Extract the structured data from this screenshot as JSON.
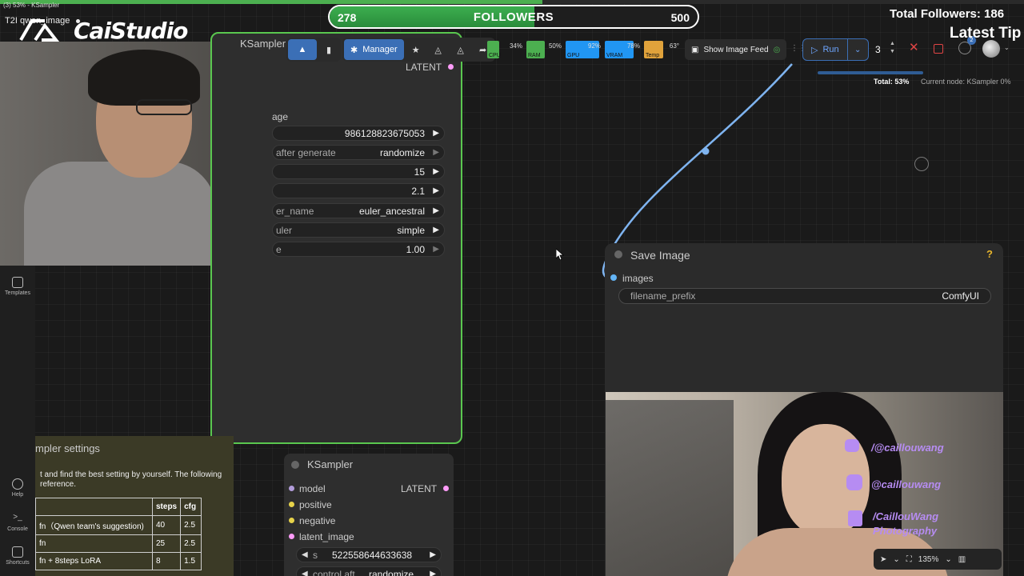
{
  "window": {
    "title": "(3) 53% - KSampler"
  },
  "workflow_tab": {
    "name": "T2I qwen_image"
  },
  "overlay": {
    "logo_text": "CaiStudio",
    "followers": {
      "current": "278",
      "label": "FOLLOWERS",
      "goal": "500",
      "progress": 0.556
    },
    "total_followers": "Total Followers: 186",
    "latest_tip": "Latest Tip",
    "socials": [
      {
        "icon": "youtube-icon",
        "handle": "/@caillouwang"
      },
      {
        "icon": "instagram-icon",
        "handle": "@caillouwang"
      },
      {
        "icon": "facebook-icon",
        "handle": "/CaillouWang"
      },
      {
        "icon": "",
        "handle": "Photography"
      }
    ]
  },
  "toolbar": {
    "manager_label": "Manager",
    "monitors": [
      {
        "label": "CPU",
        "pct": "34%",
        "color": "#4caf50"
      },
      {
        "label": "RAM",
        "pct": "50%",
        "color": "#4caf50"
      },
      {
        "label": "GPU",
        "pct": "92%",
        "color": "#2196f3"
      },
      {
        "label": "VRAM",
        "pct": "78%",
        "color": "#2196f3"
      },
      {
        "label": "Temp",
        "pct": "63°",
        "color": "#e0a23b"
      }
    ],
    "show_feed_label": "Show Image Feed",
    "run_label": "Run",
    "batch_count": "3",
    "queue_badge": "2"
  },
  "progress": {
    "total": "Total: 53%",
    "current_node": "Current node: KSampler 0%"
  },
  "ksampler_top": {
    "title": "KSampler",
    "output": "LATENT",
    "image_label": "age",
    "widgets": [
      {
        "label": "",
        "value": "986128823675053",
        "dim": false
      },
      {
        "label": "after generate",
        "value": "randomize",
        "dim": true
      },
      {
        "label": "",
        "value": "15",
        "dim": false
      },
      {
        "label": "",
        "value": "2.1",
        "dim": false
      },
      {
        "label": "er_name",
        "value": "euler_ancestral",
        "dim": false
      },
      {
        "label": "uler",
        "value": "simple",
        "dim": false
      },
      {
        "label": "e",
        "value": "1.00",
        "dim": true
      }
    ]
  },
  "save_image": {
    "title": "Save Image",
    "help": "?",
    "input": "images",
    "prefix_label": "filename_prefix",
    "prefix_value": "ComfyUI"
  },
  "sidebar": {
    "templates": "Templates",
    "help": "Help",
    "console": "Console",
    "shortcuts": "Shortcuts"
  },
  "note": {
    "title": "mpler settings",
    "text": "t and find the best setting by yourself. The following reference.",
    "table": {
      "headers": [
        "",
        "steps",
        "cfg"
      ],
      "rows": [
        [
          "fn（Qwen team's suggestion)",
          "40",
          "2.5"
        ],
        [
          "fn",
          "25",
          "2.5"
        ],
        [
          "fn + 8steps LoRA",
          "8",
          "1.5"
        ]
      ]
    }
  },
  "ksampler_bottom": {
    "title": "KSampler",
    "inputs": [
      "model",
      "positive",
      "negative",
      "latent_image"
    ],
    "output": "LATENT",
    "seed_label": "s",
    "seed_value": "522558644633638",
    "control_label": "control aft",
    "control_value": "randomize"
  },
  "canvas_tools": {
    "zoom": "135%"
  }
}
